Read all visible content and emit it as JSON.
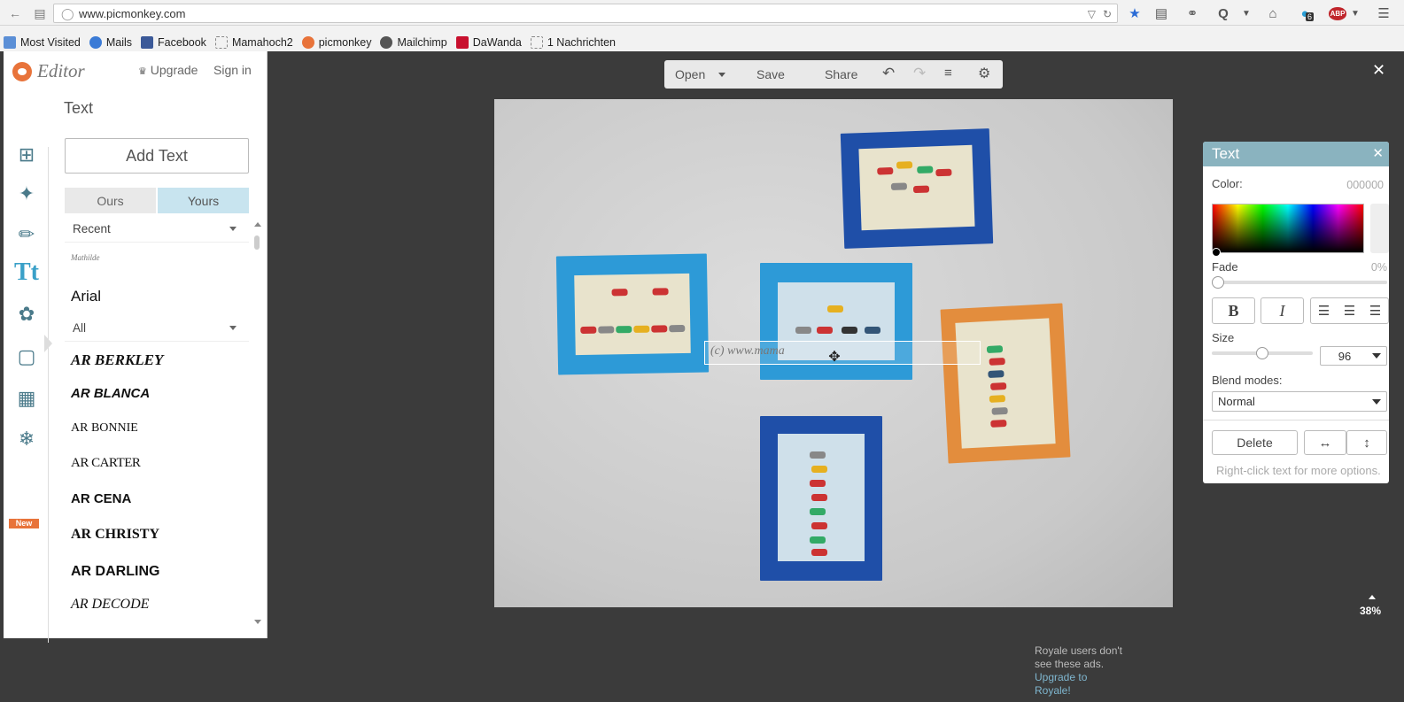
{
  "browser": {
    "url": "www.picmonkey.com",
    "badge_count": "6",
    "adblock_label": "ABP",
    "bookmarks": [
      "Most Visited",
      "Mails",
      "Facebook",
      "Mamahoch2",
      "picmonkey",
      "Mailchimp",
      "DaWanda",
      "1 Nachrichten"
    ]
  },
  "sidebar": {
    "logo_text": "Editor",
    "upgrade_label": "Upgrade",
    "signin_label": "Sign in",
    "tools": [
      "crop-icon",
      "magic-wand-icon",
      "paintbrush-icon",
      "text-icon",
      "butterfly-icon",
      "frame-icon",
      "texture-icon",
      "snowflake-icon"
    ],
    "text_tool_glyph": "Tt",
    "new_badge": "New"
  },
  "text_panel": {
    "title": "Text",
    "add_text_label": "Add Text",
    "tab_ours": "Ours",
    "tab_yours": "Yours",
    "recent_label": "Recent",
    "recent_font_sample": "Mathilde",
    "arial_label": "Arial",
    "filter_label": "All",
    "fonts": [
      "AR BERKLEY",
      "AR BLANCA",
      "AR BONNIE",
      "AR CARTER",
      "AR CENA",
      "AR CHRISTY",
      "AR DARLING",
      "AR DECODE"
    ]
  },
  "toolbar": {
    "open_label": "Open",
    "save_label": "Save",
    "share_label": "Share"
  },
  "canvas": {
    "text_content": "(c) www.mama"
  },
  "text_props": {
    "title": "Text",
    "color_label": "Color:",
    "color_value": "000000",
    "fade_label": "Fade",
    "fade_value": "0%",
    "bold_label": "B",
    "italic_label": "I",
    "size_label": "Size",
    "size_value": "96",
    "blend_label": "Blend modes:",
    "blend_value": "Normal",
    "delete_label": "Delete",
    "hint": "Right-click text for more options."
  },
  "zoom": "38%",
  "ad": {
    "line1": "Royale users don't",
    "line2": "see these ads.",
    "link1": "Upgrade to",
    "link2": "Royale!"
  },
  "colors": {
    "accent": "#3aa0c8",
    "panel_header": "#8ab3bf",
    "brand": "#e8733a"
  }
}
